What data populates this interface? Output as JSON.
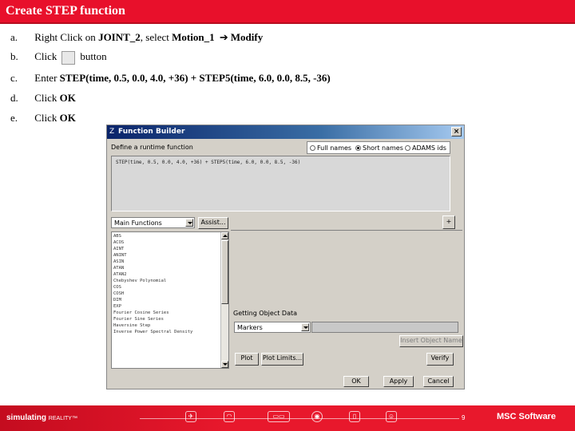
{
  "title": "Create STEP function",
  "steps": {
    "a": {
      "letter": "a.",
      "text_pre": "Right Click on ",
      "joint": "JOINT_2",
      "text_mid": ", select ",
      "motion": "Motion_1",
      "arrow": "➔",
      "modify": "Modify"
    },
    "b": {
      "letter": "b.",
      "text_pre": "Click",
      "text_post": "button"
    },
    "c": {
      "letter": "c.",
      "text_pre": "Enter ",
      "expression": "STEP(time, 0.5, 0.0, 4.0, +36) + STEP5(time, 6.0, 0.0, 8.5, -36)"
    },
    "d": {
      "letter": "d.",
      "text_pre": "Click ",
      "ok": "OK"
    },
    "e": {
      "letter": "e.",
      "text_pre": "Click ",
      "ok": "OK"
    }
  },
  "dialog": {
    "title": "Function Builder",
    "app_icon": "Z",
    "close_glyph": "×",
    "define_label": "Define a runtime function",
    "name_options": [
      {
        "label": "Full names",
        "selected": false
      },
      {
        "label": "Short names",
        "selected": true
      },
      {
        "label": "ADAMS ids",
        "selected": false
      }
    ],
    "expression": "STEP(time, 0.5, 0.0, 4.0, +36) + STEP5(time, 6.0, 0.0, 8.5, -36)",
    "function_category": "Main Functions",
    "assist_label": "Assist...",
    "plus_label": "+",
    "functions": [
      "ABS",
      "ACOS",
      "AINT",
      "ANINT",
      "ASIN",
      "ATAN",
      "ATAN2",
      "Chebyshev Polynomial",
      "COS",
      "COSH",
      "DIM",
      "EXP",
      "Fourier Cosine Series",
      "Fourier Sine Series",
      "Haversine Step",
      "Inverse Power Spectral Density"
    ],
    "getting_object_label": "Getting Object Data",
    "object_type": "Markers",
    "insert_label": "Insert Object Name",
    "plot_label": "Plot",
    "plot_limits_label": "Plot Limits...",
    "verify_label": "Verify",
    "ok_label": "OK",
    "apply_label": "Apply",
    "cancel_label": "Cancel"
  },
  "footer": {
    "tagline": "simulating",
    "tagline_tm": "REALITY™",
    "page_number": "9",
    "logo": "MSC Software",
    "icons": [
      "airplane-icon",
      "car-icon",
      "train-icon",
      "target-icon",
      "bottle-icon",
      "human-figure-icon"
    ]
  },
  "colors": {
    "brand_red": "#e8102b",
    "dialog_gray": "#d4d0c8",
    "dialog_title": "#0a246a"
  }
}
